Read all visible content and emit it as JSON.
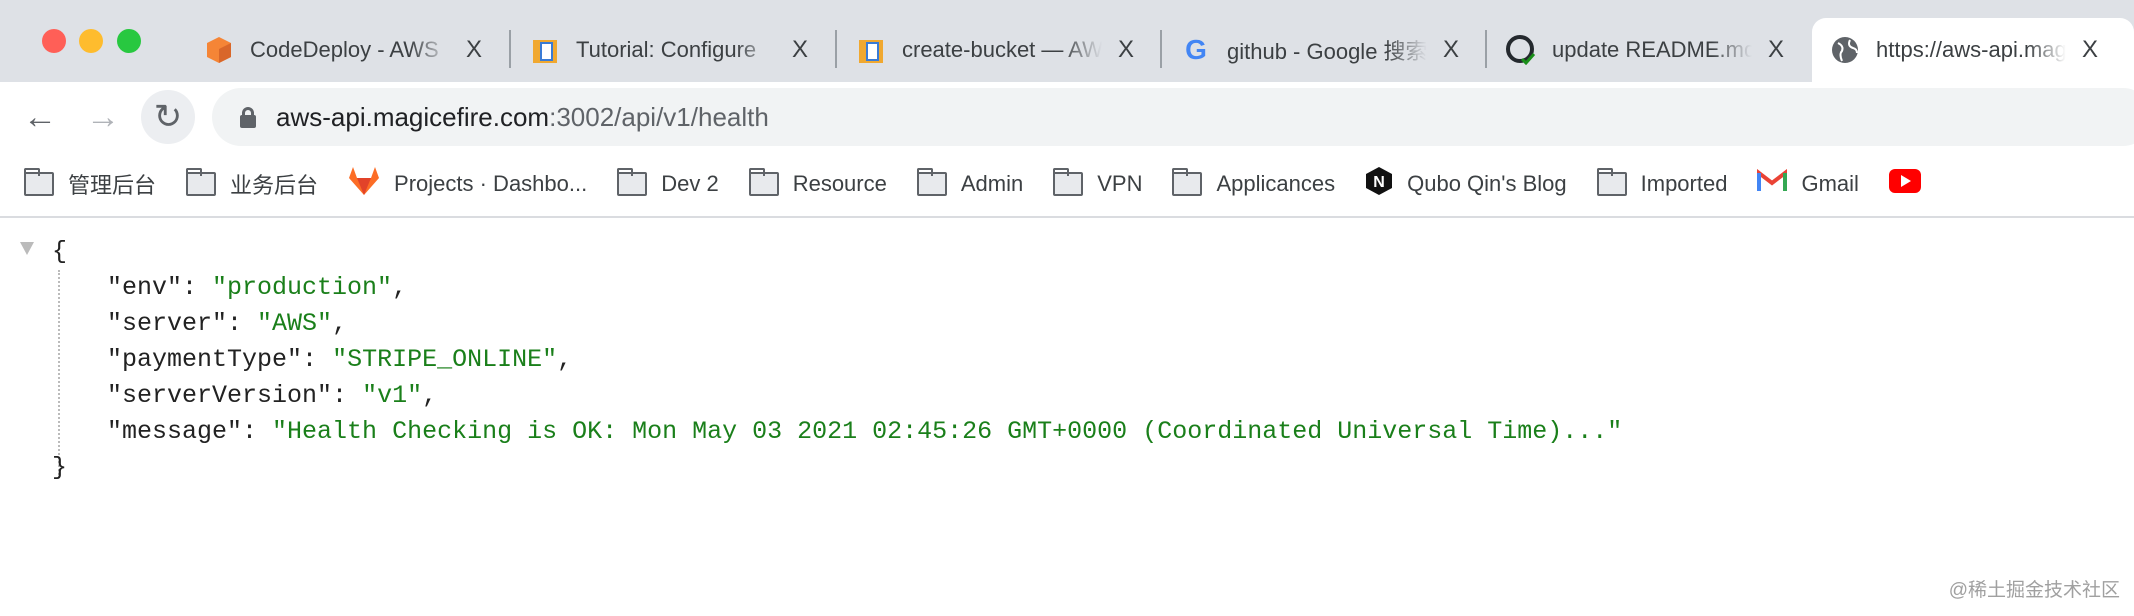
{
  "window": {
    "traffic_lights": {
      "close": "#ff5f57",
      "minimize": "#febc2e",
      "maximize": "#28c840"
    }
  },
  "tabs": [
    {
      "title": "CodeDeploy - AWS",
      "icon": "aws-codedeploy-icon",
      "active": false
    },
    {
      "title": "Tutorial: Configure",
      "icon": "aws-docs-icon",
      "active": false
    },
    {
      "title": "create-bucket — AWS",
      "icon": "aws-docs-icon",
      "active": false
    },
    {
      "title": "github - Google 搜索",
      "icon": "google-icon",
      "active": false
    },
    {
      "title": "update README.md",
      "icon": "github-icon",
      "active": false
    },
    {
      "title": "https://aws-api.magicefire.com",
      "icon": "globe-icon",
      "active": true
    }
  ],
  "tab_close_label": "X",
  "toolbar": {
    "back": "←",
    "forward": "→",
    "reload": "↻",
    "url_host": "aws-api.magicefire.com",
    "url_path": ":3002/api/v1/health"
  },
  "bookmarks": [
    {
      "label": "管理后台",
      "icon": "folder-icon"
    },
    {
      "label": "业务后台",
      "icon": "folder-icon"
    },
    {
      "label": "Projects · Dashbo...",
      "icon": "gitlab-icon"
    },
    {
      "label": "Dev 2",
      "icon": "folder-icon"
    },
    {
      "label": "Resource",
      "icon": "folder-icon"
    },
    {
      "label": "Admin",
      "icon": "folder-icon"
    },
    {
      "label": "VPN",
      "icon": "folder-icon"
    },
    {
      "label": "Applicances",
      "icon": "folder-icon"
    },
    {
      "label": "Qubo Qin's Blog",
      "icon": "notion-n-icon"
    },
    {
      "label": "Imported",
      "icon": "folder-icon"
    },
    {
      "label": "Gmail",
      "icon": "gmail-icon"
    }
  ],
  "json_view": {
    "open": "{",
    "close": "}",
    "entries": [
      {
        "key": "\"env\"",
        "value": "\"production\"",
        "trail": ","
      },
      {
        "key": "\"server\"",
        "value": "\"AWS\"",
        "trail": ","
      },
      {
        "key": "\"paymentType\"",
        "value": "\"STRIPE_ONLINE\"",
        "trail": ","
      },
      {
        "key": "\"serverVersion\"",
        "value": "\"v1\"",
        "trail": ","
      },
      {
        "key": "\"message\"",
        "value": "\"Health Checking is OK: Mon May 03 2021 02:45:26 GMT+0000 (Coordinated Universal Time)...\"",
        "trail": ""
      }
    ],
    "colon": ": ",
    "string_color": "#1a7f1a"
  },
  "watermark": "@稀土掘金技术社区"
}
